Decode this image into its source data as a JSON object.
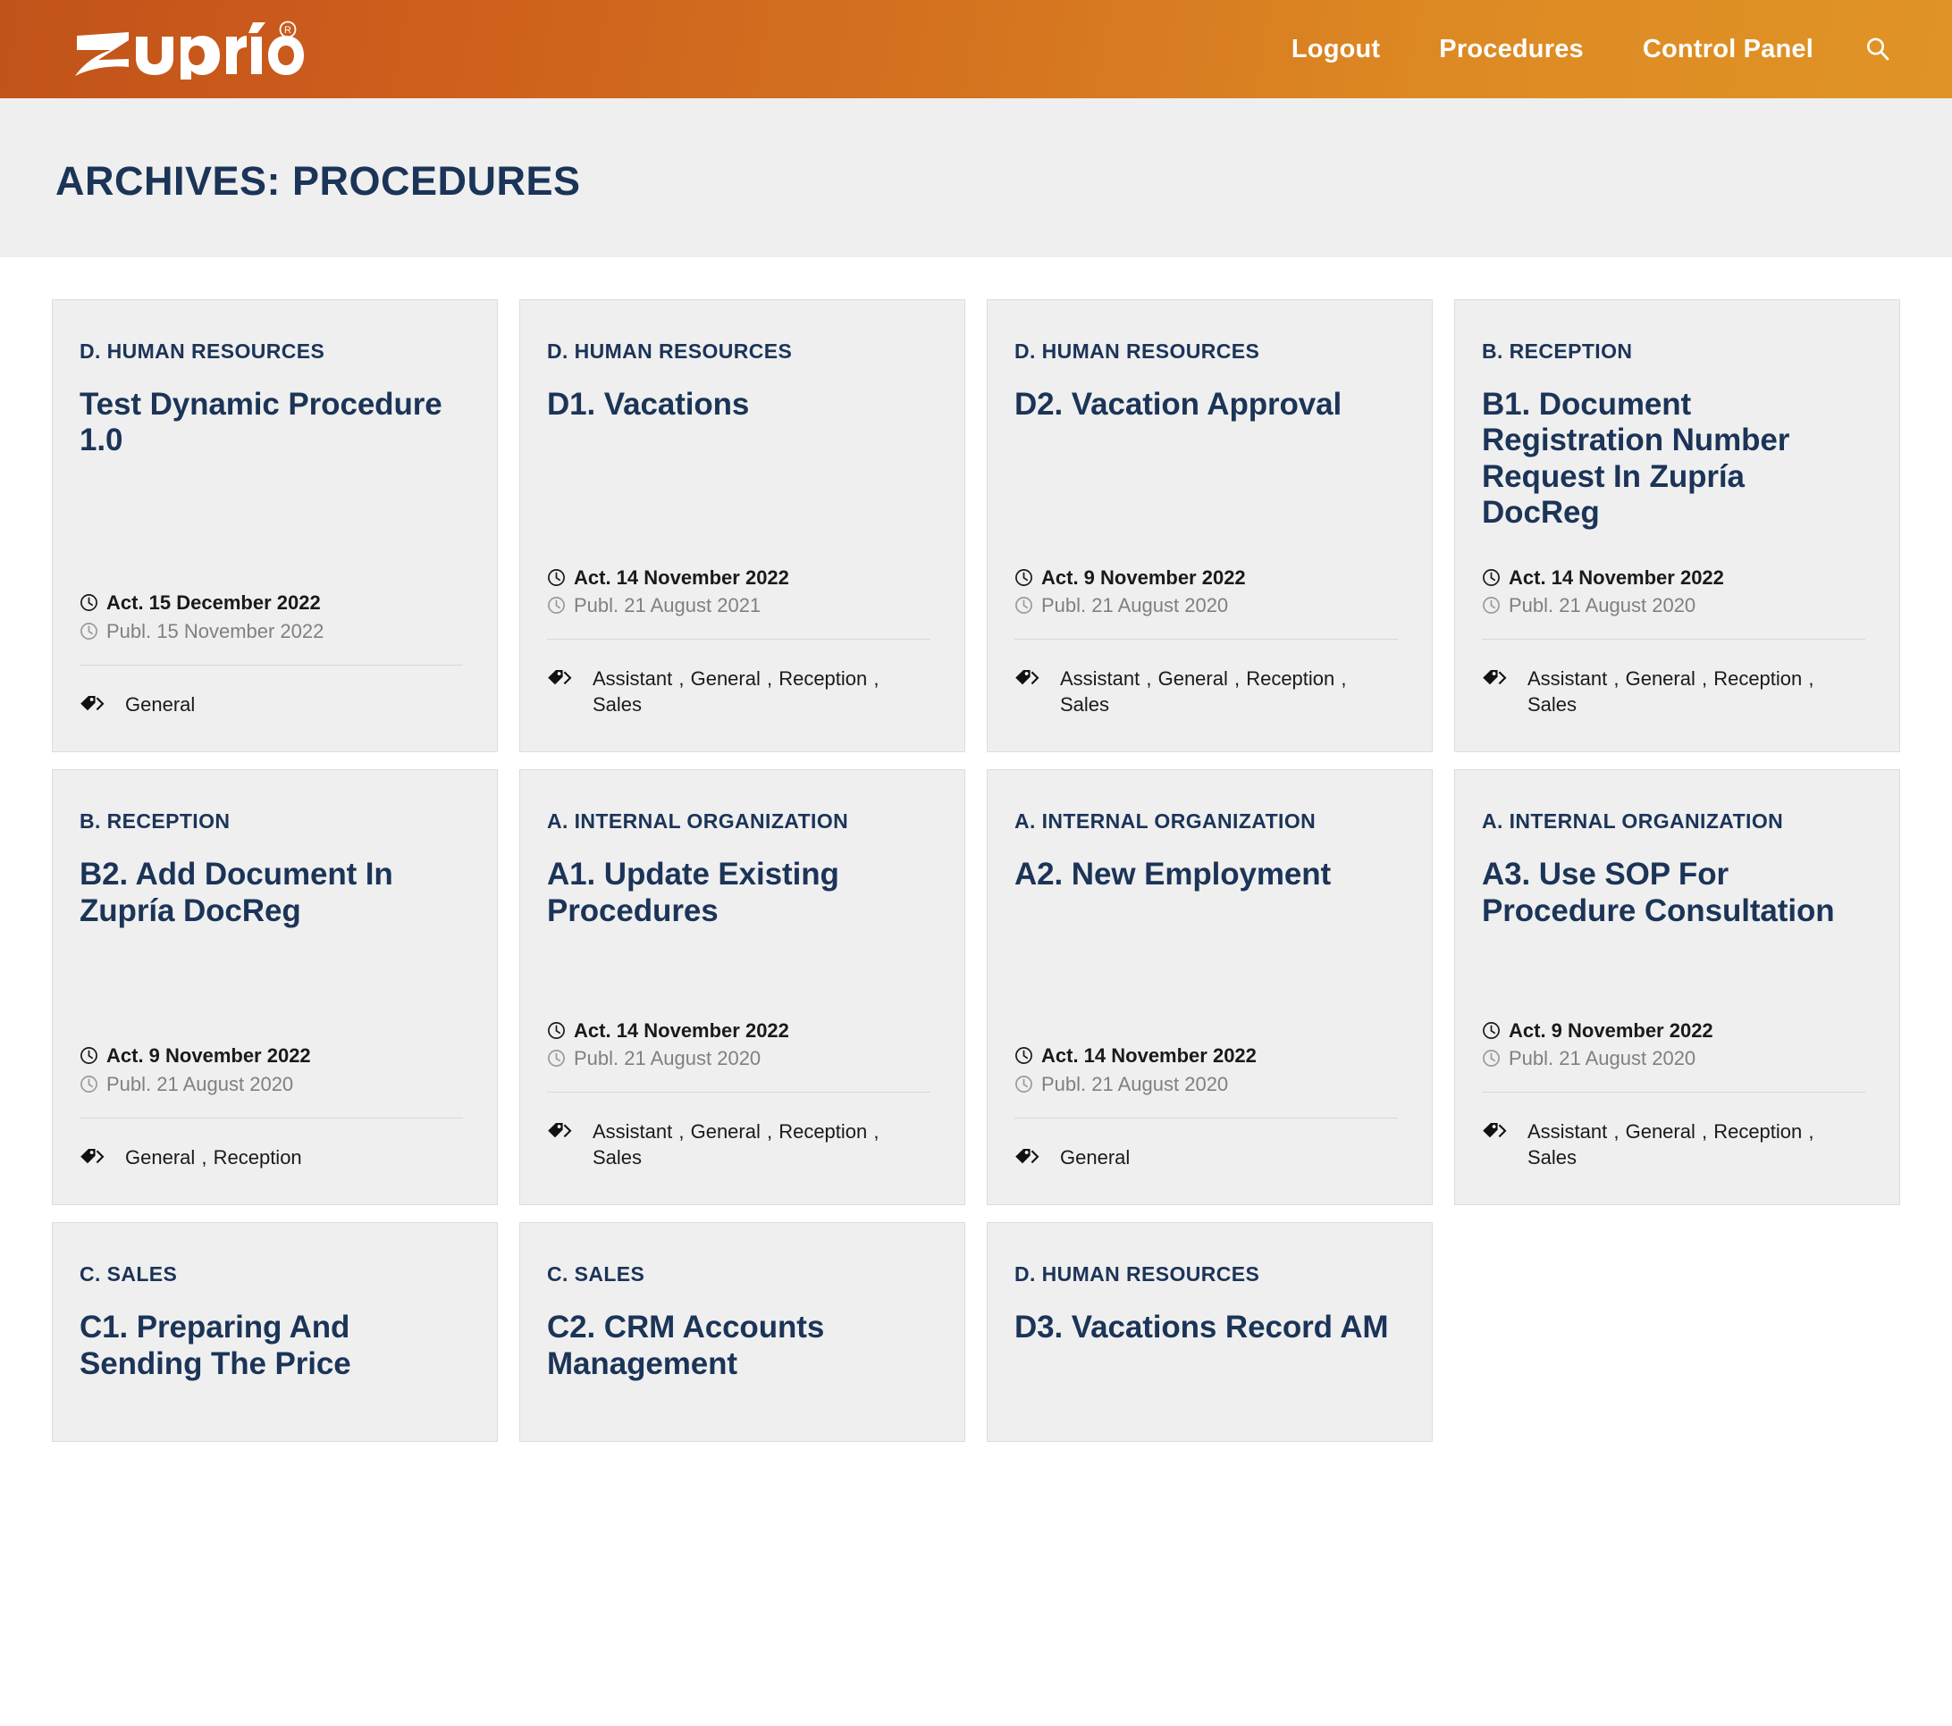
{
  "header": {
    "brand": "zupría",
    "brand_trademark": "®",
    "nav": [
      {
        "label": "Logout",
        "name": "nav-logout"
      },
      {
        "label": "Procedures",
        "name": "nav-procedures"
      },
      {
        "label": "Control Panel",
        "name": "nav-control-panel"
      }
    ],
    "search_icon": "search-icon",
    "gradient_from": "#c0531a",
    "gradient_to": "#e09425"
  },
  "page": {
    "title": "ARCHIVES: PROCEDURES",
    "title_color": "#1b3458",
    "title_band_bg": "#efefef",
    "card_bg": "#efefef",
    "card_border": "#dcdcdc"
  },
  "cards": [
    {
      "category": "D. HUMAN RESOURCES",
      "title": "Test Dynamic Procedure 1.0",
      "act": "Act. 15 December 2022",
      "publ": "Publ. 15 November 2022",
      "tags": "General"
    },
    {
      "category": "D. HUMAN RESOURCES",
      "title": "D1. Vacations",
      "act": "Act. 14 November 2022",
      "publ": "Publ. 21 August 2021",
      "tags": "Assistant , General , Reception , Sales"
    },
    {
      "category": "D. HUMAN RESOURCES",
      "title": "D2. Vacation Approval",
      "act": "Act. 9 November 2022",
      "publ": "Publ. 21 August 2020",
      "tags": "Assistant , General , Reception , Sales"
    },
    {
      "category": "B. RECEPTION",
      "title": "B1. Document Registration Number Request In Zupría DocReg",
      "act": "Act. 14 November 2022",
      "publ": "Publ. 21 August 2020",
      "tags": "Assistant , General , Reception , Sales"
    },
    {
      "category": "B. RECEPTION",
      "title": "B2. Add Document In Zupría DocReg",
      "act": "Act. 9 November 2022",
      "publ": "Publ. 21 August 2020",
      "tags": "General , Reception"
    },
    {
      "category": "A. INTERNAL ORGANIZATION",
      "title": "A1. Update Existing Procedures",
      "act": "Act. 14 November 2022",
      "publ": "Publ. 21 August 2020",
      "tags": "Assistant , General , Reception , Sales"
    },
    {
      "category": "A. INTERNAL ORGANIZATION",
      "title": "A2. New Employment",
      "act": "Act. 14 November 2022",
      "publ": "Publ. 21 August 2020",
      "tags": "General"
    },
    {
      "category": "A. INTERNAL ORGANIZATION",
      "title": "A3. Use SOP For Procedure Consultation",
      "act": "Act. 9 November 2022",
      "publ": "Publ. 21 August 2020",
      "tags": "Assistant , General , Reception , Sales"
    },
    {
      "category": "C. SALES",
      "title": "C1. Preparing And Sending The Price",
      "act": "",
      "publ": "",
      "tags": ""
    },
    {
      "category": "C. SALES",
      "title": "C2. CRM Accounts Management",
      "act": "",
      "publ": "",
      "tags": ""
    },
    {
      "category": "D. HUMAN RESOURCES",
      "title": "D3. Vacations Record AM",
      "act": "",
      "publ": "",
      "tags": ""
    }
  ]
}
